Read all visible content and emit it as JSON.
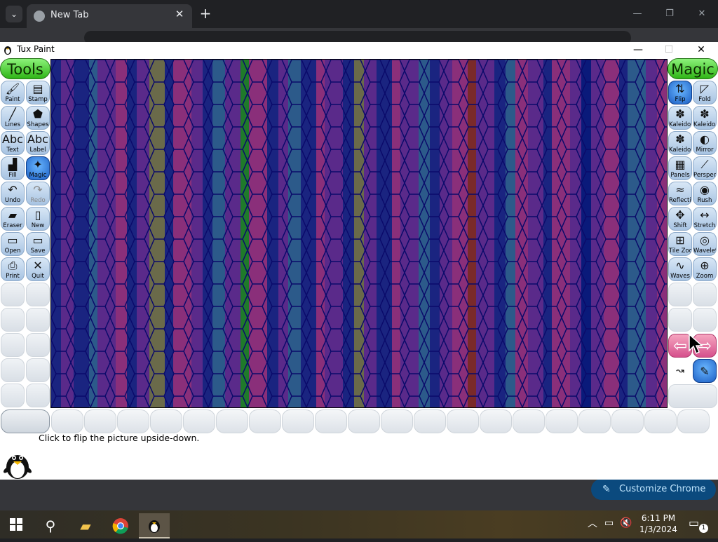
{
  "chrome": {
    "tab_title": "New Tab",
    "tab_close": "✕",
    "new_tab": "+",
    "dropdown": "⌄",
    "minimize": "—",
    "maximize": "❐",
    "close": "✕",
    "customize_label": "Customize Chrome",
    "customize_icon": "✎"
  },
  "tuxpaint": {
    "window_title": "Tux Paint",
    "minimize": "—",
    "maximize": "☐",
    "close": "✕",
    "tools_header": "Tools",
    "magic_header": "Magic",
    "tools": [
      {
        "label": "Paint",
        "glyph": "🖌"
      },
      {
        "label": "Stamp",
        "glyph": "▤"
      },
      {
        "label": "Lines",
        "glyph": "╱"
      },
      {
        "label": "Shapes",
        "glyph": "⬟"
      },
      {
        "label": "Text",
        "glyph": "Abc"
      },
      {
        "label": "Label",
        "glyph": "Abc"
      },
      {
        "label": "Fill",
        "glyph": "▟"
      },
      {
        "label": "Magic",
        "glyph": "✦"
      },
      {
        "label": "Undo",
        "glyph": "↶"
      },
      {
        "label": "Redo",
        "glyph": "↷"
      },
      {
        "label": "Eraser",
        "glyph": "▰"
      },
      {
        "label": "New",
        "glyph": "▯"
      },
      {
        "label": "Open",
        "glyph": "▭"
      },
      {
        "label": "Save",
        "glyph": "▭"
      },
      {
        "label": "Print",
        "glyph": "⎙"
      },
      {
        "label": "Quit",
        "glyph": "✕"
      }
    ],
    "magic_tools": [
      {
        "label": "Flip",
        "glyph": "⇅"
      },
      {
        "label": "Fold",
        "glyph": "◸"
      },
      {
        "label": "Kaleido...",
        "glyph": "✽"
      },
      {
        "label": "Kaleido...",
        "glyph": "✽"
      },
      {
        "label": "Kaleido-8",
        "glyph": "✽"
      },
      {
        "label": "Mirror",
        "glyph": "◐"
      },
      {
        "label": "Panels",
        "glyph": "▦"
      },
      {
        "label": "Perspective",
        "glyph": "⟋"
      },
      {
        "label": "Reflection",
        "glyph": "≈"
      },
      {
        "label": "Rush",
        "glyph": "◉"
      },
      {
        "label": "Shift",
        "glyph": "✥"
      },
      {
        "label": "Stretch",
        "glyph": "↔"
      },
      {
        "label": "Tile Zoom",
        "glyph": "⊞"
      },
      {
        "label": "Wavelets",
        "glyph": "◎"
      },
      {
        "label": "Waves",
        "glyph": "∿"
      },
      {
        "label": "Zoom",
        "glyph": "⊕"
      }
    ],
    "nav_left": "⇦",
    "nav_right": "⇨",
    "mode_paint": "↝",
    "mode_full": "✎",
    "status_text": "Click to flip the picture upside-down.",
    "selected_tool": "Magic",
    "selected_magic": "Flip"
  },
  "taskbar": {
    "time": "6:11 PM",
    "date": "1/3/2024",
    "notification_count": "1",
    "search_glyph": "⚲",
    "folder_glyph": "▰",
    "chevron_glyph": "︿",
    "network_glyph": "▭",
    "volume_glyph": "🔇",
    "notif_glyph": "▭"
  },
  "colors": {
    "canvas_stripes": [
      "#1a2480",
      "#5a2a8a",
      "#8a2f7a",
      "#2c5a8a",
      "#6a6a4a",
      "#1f7a2a",
      "#7a2a2a",
      "#0a1a7a"
    ]
  }
}
